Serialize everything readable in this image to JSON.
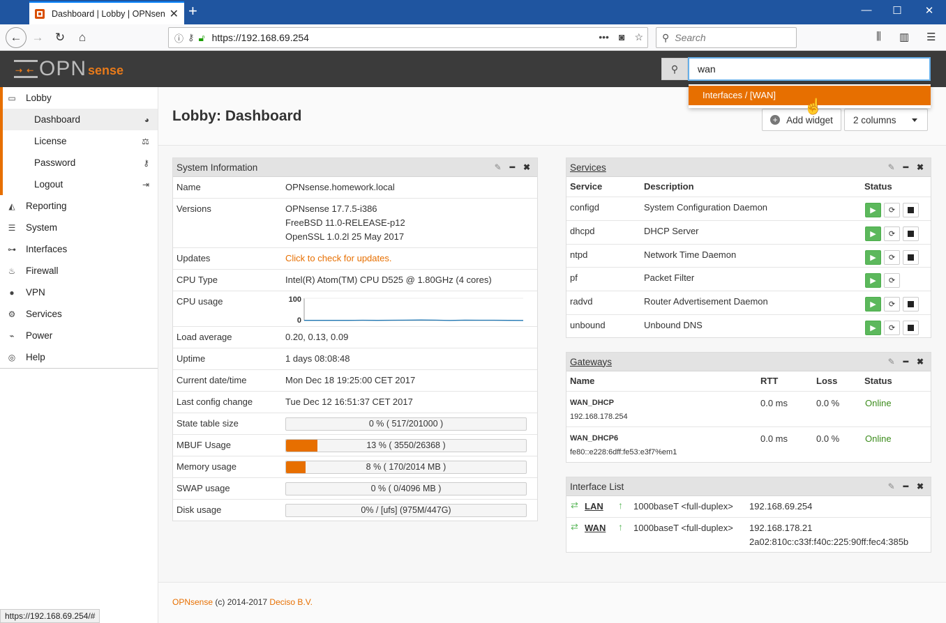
{
  "browser": {
    "tab_title": "Dashboard | Lobby | OPNsense",
    "url": "https://192.168.69.254",
    "search_placeholder": "Search",
    "status_url": "https://192.168.69.254/#"
  },
  "header": {
    "logo_opn": "OPN",
    "logo_sense": "sense",
    "search_value": "wan",
    "suggestion": "Interfaces / [WAN]"
  },
  "sidebar": {
    "items": [
      {
        "label": "Lobby",
        "icon": "laptop-icon"
      },
      {
        "label": "Dashboard",
        "icon": "dashboard-icon"
      },
      {
        "label": "License",
        "icon": "balance-scale-icon"
      },
      {
        "label": "Password",
        "icon": "key-icon"
      },
      {
        "label": "Logout",
        "icon": "sign-out-icon"
      },
      {
        "label": "Reporting",
        "icon": "area-chart-icon"
      },
      {
        "label": "System",
        "icon": "server-icon"
      },
      {
        "label": "Interfaces",
        "icon": "sitemap-icon"
      },
      {
        "label": "Firewall",
        "icon": "fire-icon"
      },
      {
        "label": "VPN",
        "icon": "globe-icon"
      },
      {
        "label": "Services",
        "icon": "cog-icon"
      },
      {
        "label": "Power",
        "icon": "plug-icon"
      },
      {
        "label": "Help",
        "icon": "life-ring-icon"
      }
    ]
  },
  "page": {
    "title": "Lobby: Dashboard",
    "add_widget": "Add widget",
    "columns": "2 columns"
  },
  "sysinfo": {
    "title": "System Information",
    "rows": {
      "name_k": "Name",
      "name_v": "OPNsense.homework.local",
      "versions_k": "Versions",
      "versions_v1": "OPNsense 17.7.5-i386",
      "versions_v2": "FreeBSD 11.0-RELEASE-p12",
      "versions_v3": "OpenSSL 1.0.2l 25 May 2017",
      "updates_k": "Updates",
      "updates_v": "Click to check for updates.",
      "cputype_k": "CPU Type",
      "cputype_v": "Intel(R) Atom(TM) CPU D525 @ 1.80GHz (4 cores)",
      "cpuusage_k": "CPU usage",
      "load_k": "Load average",
      "load_v": "0.20, 0.13, 0.09",
      "uptime_k": "Uptime",
      "uptime_v": "1 days 08:08:48",
      "date_k": "Current date/time",
      "date_v": "Mon Dec 18 19:25:00 CET 2017",
      "config_k": "Last config change",
      "config_v": "Tue Dec 12 16:51:37 CET 2017",
      "state_k": "State table size",
      "state_v": "0 % ( 517/201000 )",
      "state_pct": 0,
      "mbuf_k": "MBUF Usage",
      "mbuf_v": "13 % ( 3550/26368 )",
      "mbuf_pct": 13,
      "mem_k": "Memory usage",
      "mem_v": "8 % ( 170/2014 MB )",
      "mem_pct": 8,
      "swap_k": "SWAP usage",
      "swap_v": "0 % ( 0/4096 MB )",
      "swap_pct": 0,
      "disk_k": "Disk usage",
      "disk_v": "0% / [ufs] (975M/447G)",
      "disk_pct": 0
    }
  },
  "chart_data": {
    "type": "line",
    "title": "",
    "ylim": [
      0,
      100
    ],
    "yticks": [
      "100",
      "0"
    ],
    "values": [
      1,
      1,
      1,
      1,
      1.5,
      1,
      1.5,
      2,
      2.5,
      2,
      0.5,
      2,
      1.5,
      1.5,
      1,
      0.5
    ]
  },
  "services": {
    "title": "Services",
    "headers": [
      "Service",
      "Description",
      "Status"
    ],
    "rows": [
      {
        "name": "configd",
        "desc": "System Configuration Daemon",
        "stop": true
      },
      {
        "name": "dhcpd",
        "desc": "DHCP Server",
        "stop": true
      },
      {
        "name": "ntpd",
        "desc": "Network Time Daemon",
        "stop": true
      },
      {
        "name": "pf",
        "desc": "Packet Filter",
        "stop": false
      },
      {
        "name": "radvd",
        "desc": "Router Advertisement Daemon",
        "stop": true
      },
      {
        "name": "unbound",
        "desc": "Unbound DNS",
        "stop": true
      }
    ]
  },
  "gateways": {
    "title": "Gateways",
    "headers": [
      "Name",
      "RTT",
      "Loss",
      "Status"
    ],
    "rows": [
      {
        "name": "WAN_DHCP",
        "addr": "192.168.178.254",
        "rtt": "0.0 ms",
        "loss": "0.0 %",
        "status": "Online"
      },
      {
        "name": "WAN_DHCP6",
        "addr": "fe80::e228:6dff:fe53:e3f7%em1",
        "rtt": "0.0 ms",
        "loss": "0.0 %",
        "status": "Online"
      }
    ]
  },
  "interfaces": {
    "title": "Interface List",
    "rows": [
      {
        "name": "LAN",
        "media": "1000baseT <full-duplex>",
        "ip1": "192.168.69.254",
        "ip2": ""
      },
      {
        "name": "WAN",
        "media": "1000baseT <full-duplex>",
        "ip1": "192.168.178.21",
        "ip2": "2a02:810c:c33f:f40c:225:90ff:fec4:385b"
      }
    ]
  },
  "footer": {
    "brand": "OPNsense",
    "copy": " (c) 2014-2017 ",
    "company": "Deciso B.V."
  },
  "colors": {
    "accent": "#e76f00",
    "online": "#3c8c1c",
    "header_bg": "#3b3b3b"
  }
}
